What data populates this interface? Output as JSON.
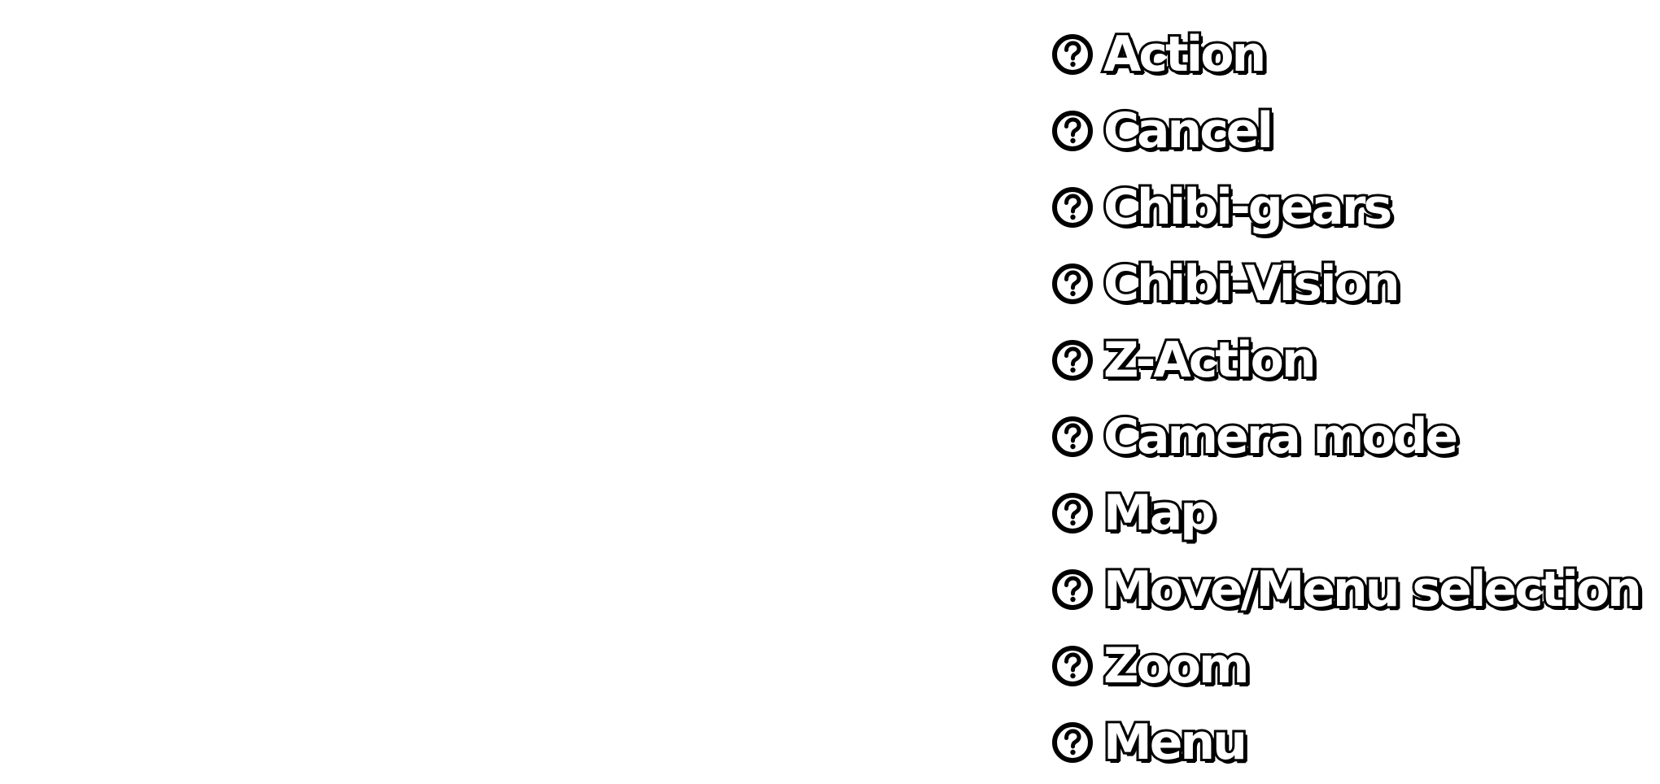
{
  "controls": [
    {
      "icon": "question-mark-button-icon",
      "label": "Action"
    },
    {
      "icon": "question-mark-button-icon",
      "label": "Cancel"
    },
    {
      "icon": "question-mark-button-icon",
      "label": "Chibi-gears"
    },
    {
      "icon": "question-mark-button-icon",
      "label": "Chibi-Vision"
    },
    {
      "icon": "question-mark-button-icon",
      "label": "Z-Action"
    },
    {
      "icon": "question-mark-button-icon",
      "label": "Camera mode"
    },
    {
      "icon": "question-mark-button-icon",
      "label": "Map"
    },
    {
      "icon": "question-mark-button-icon",
      "label": "Move/Menu selection"
    },
    {
      "icon": "question-mark-button-icon",
      "label": "Zoom"
    },
    {
      "icon": "question-mark-button-icon",
      "label": "Menu"
    }
  ],
  "colors": {
    "label_fill": "#ffffff",
    "label_outline": "#000000",
    "background": "#ffffff"
  }
}
